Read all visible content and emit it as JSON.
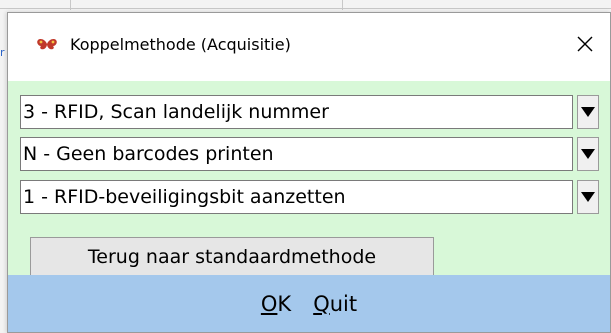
{
  "window": {
    "title": "Koppelmethode (Acquisitie)",
    "close_label": "×",
    "icon": "butterfly-logo-icon"
  },
  "selects": [
    {
      "value": "3 - RFID, Scan landelijk nummer"
    },
    {
      "value": "N - Geen barcodes printen"
    },
    {
      "value": "1 - RFID-beveiligingsbit aanzetten"
    }
  ],
  "reset_button_label": "Terug naar standaardmethode",
  "footer": {
    "ok_mnemonic": "O",
    "ok_rest": "K",
    "quit_mnemonic": "Q",
    "quit_rest": "uit"
  },
  "colors": {
    "content_bg": "#d8f8d8",
    "footer_bg": "#a4c8ec",
    "icon_color": "#c0392b"
  }
}
